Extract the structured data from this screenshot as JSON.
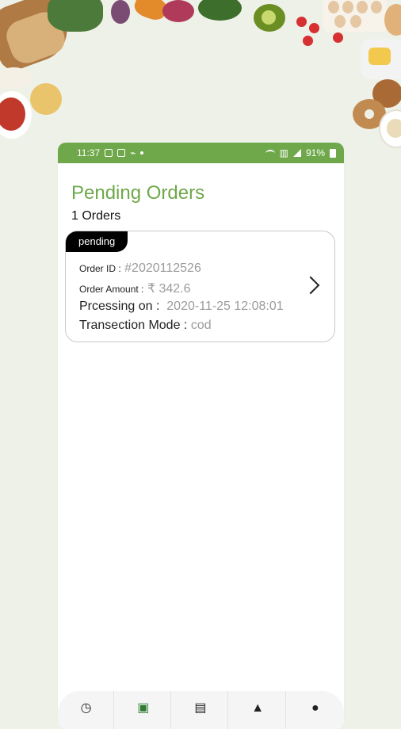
{
  "status_bar": {
    "time": "11:37",
    "battery": "91%"
  },
  "page": {
    "title": "Pending Orders",
    "count_text": "1 Orders"
  },
  "order": {
    "status_badge": "pending",
    "order_id_label": "Order ID :",
    "order_id_value": "#2020112526",
    "amount_label": "Order Amount :",
    "amount_value": "₹ 342.6",
    "processing_label": "Prcessing on :",
    "processing_value": "2020-11-25 12:08:01",
    "mode_label": "Transection Mode :",
    "mode_value": "cod"
  },
  "bottom_nav": {
    "items": [
      {
        "icon": "clock-icon",
        "glyph": "◷"
      },
      {
        "icon": "save-icon",
        "glyph": "▣"
      },
      {
        "icon": "box-icon",
        "glyph": "▤"
      },
      {
        "icon": "bell-icon",
        "glyph": "▲"
      },
      {
        "icon": "user-icon",
        "glyph": "●"
      }
    ],
    "active_color": "#2e7d32"
  },
  "colors": {
    "accent": "#6fa84a",
    "badge_bg": "#000000"
  }
}
